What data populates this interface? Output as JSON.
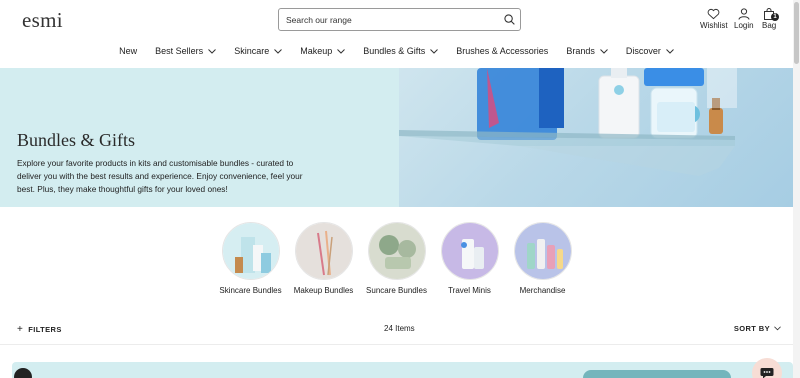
{
  "header": {
    "logo": "esmi",
    "search": {
      "placeholder": "Search our range"
    },
    "utilities": {
      "wishlist": "Wishlist",
      "login": "Login",
      "bag": "Bag",
      "bag_count": "1"
    }
  },
  "nav": [
    {
      "label": "New",
      "has_dropdown": false
    },
    {
      "label": "Best Sellers",
      "has_dropdown": true
    },
    {
      "label": "Skincare",
      "has_dropdown": true
    },
    {
      "label": "Makeup",
      "has_dropdown": true
    },
    {
      "label": "Bundles & Gifts",
      "has_dropdown": true
    },
    {
      "label": "Brushes & Accessories",
      "has_dropdown": false
    },
    {
      "label": "Brands",
      "has_dropdown": true
    },
    {
      "label": "Discover",
      "has_dropdown": true
    }
  ],
  "hero": {
    "title": "Bundles & Gifts",
    "description": "Explore your favorite products in kits and customisable bundles - curated to deliver you with the best results and experience. Enjoy convenience, feel your best. Plus, they make thoughtful gifts for your loved ones!"
  },
  "categories": [
    {
      "label": "Skincare Bundles"
    },
    {
      "label": "Makeup Bundles"
    },
    {
      "label": "Suncare Bundles"
    },
    {
      "label": "Travel Minis"
    },
    {
      "label": "Merchandise"
    }
  ],
  "toolbar": {
    "filters_label": "FILTERS",
    "items_count": "24 Items",
    "sort_label": "SORT BY"
  },
  "colors": {
    "hero_bg": "#d3edf0",
    "accent": "#74b5bc",
    "text": "#222222"
  }
}
